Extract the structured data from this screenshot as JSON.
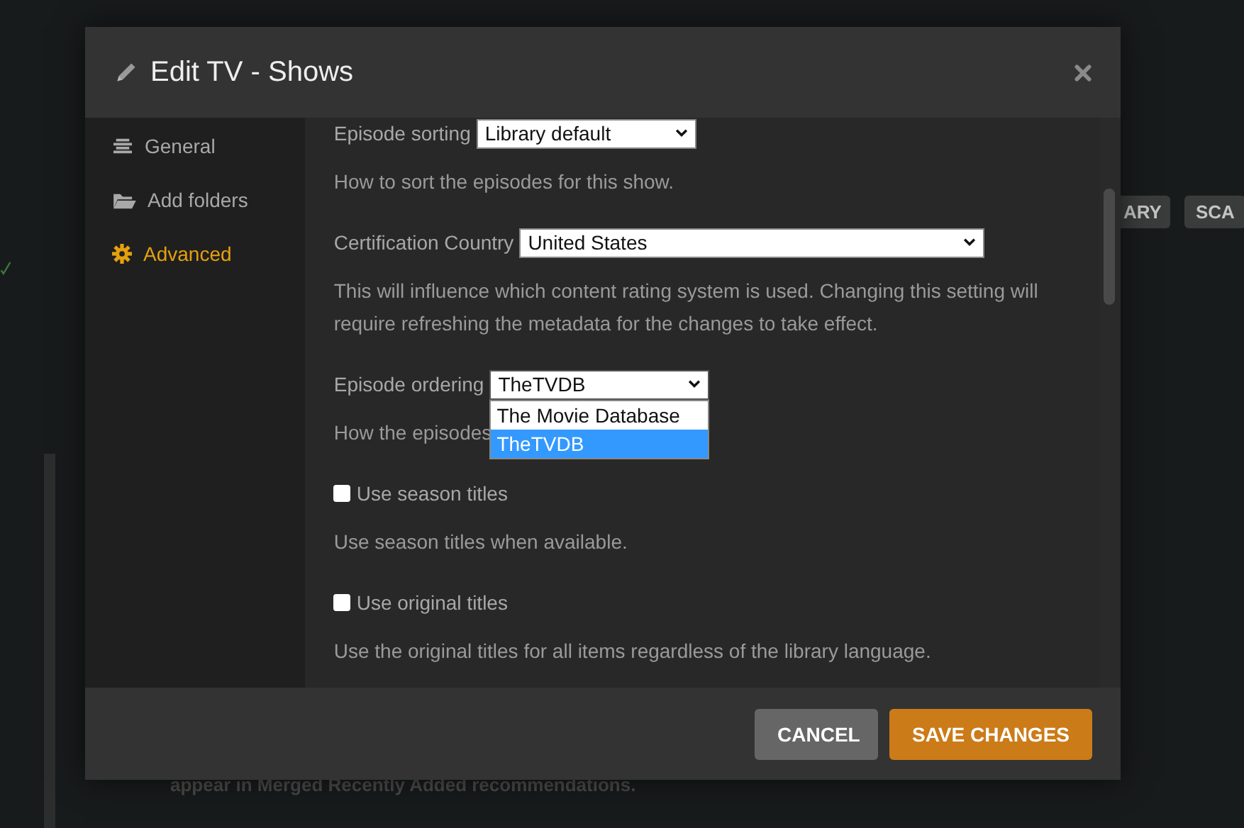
{
  "background": {
    "buttons": [
      "ARY",
      "SCA"
    ],
    "note": "appear in Merged Recently Added recommendations."
  },
  "dialog": {
    "title": "Edit TV - Shows",
    "sidebar": [
      {
        "label": "General",
        "selected": false
      },
      {
        "label": "Add folders",
        "selected": false
      },
      {
        "label": "Advanced",
        "selected": true
      }
    ],
    "settings": [
      {
        "kind": "select",
        "label": "Episode sorting",
        "value": "Library default",
        "description": "How to sort the episodes for this show."
      },
      {
        "kind": "select",
        "label": "Certification Country",
        "value": "United States",
        "description": "This will influence which content rating system is used. Changing this setting will require refreshing the metadata for the changes to take effect."
      },
      {
        "kind": "select",
        "label": "Episode ordering",
        "value": "TheTVDB",
        "open": true,
        "options": [
          {
            "label": "The Movie Database",
            "selected": false
          },
          {
            "label": "TheTVDB",
            "selected": true
          }
        ],
        "description": "How the episodes"
      },
      {
        "kind": "checkbox",
        "label": "Use season titles",
        "checked": false,
        "description": "Use season titles when available."
      },
      {
        "kind": "checkbox",
        "label": "Use original titles",
        "checked": false,
        "description": "Use the original titles for all items regardless of the library language."
      }
    ],
    "buttons": [
      {
        "label": "CANCEL",
        "kind": "secondary"
      },
      {
        "label": "SAVE CHANGES",
        "kind": "primary"
      }
    ]
  }
}
